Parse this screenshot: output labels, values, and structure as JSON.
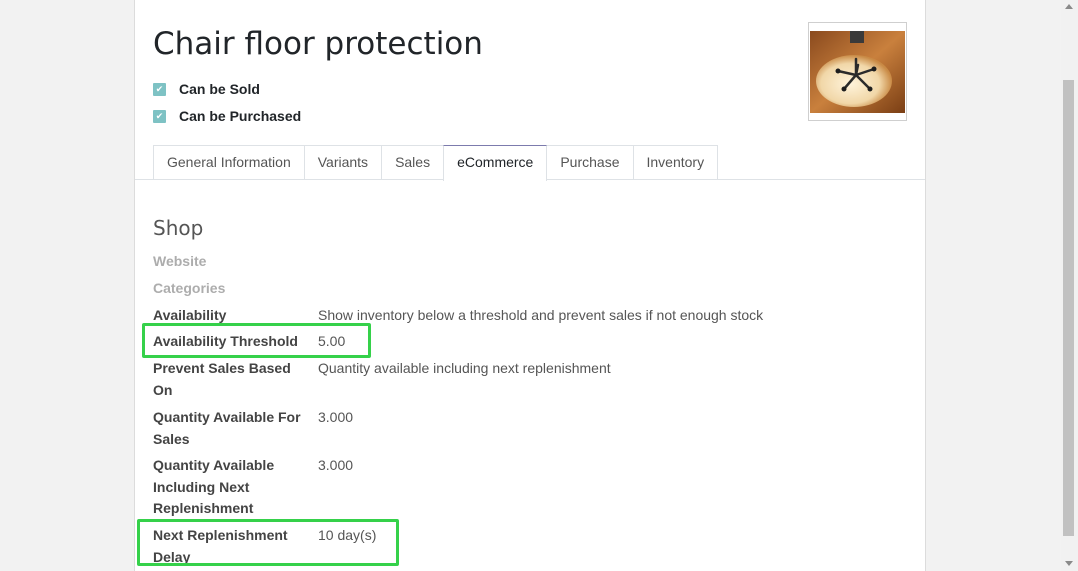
{
  "product": {
    "name": "Chair floor protection",
    "checkboxes": [
      {
        "label": "Can be Sold",
        "checked": true
      },
      {
        "label": "Can be Purchased",
        "checked": true
      }
    ],
    "image_icon": "product-photo-chair-mat"
  },
  "tabs": [
    {
      "label": "General Information",
      "active": false
    },
    {
      "label": "Variants",
      "active": false
    },
    {
      "label": "Sales",
      "active": false
    },
    {
      "label": "eCommerce",
      "active": true
    },
    {
      "label": "Purchase",
      "active": false
    },
    {
      "label": "Inventory",
      "active": false
    }
  ],
  "shop": {
    "title": "Shop",
    "website_label": "Website",
    "categories_label": "Categories",
    "availability_label": "Availability",
    "availability_value": "Show inventory below a threshold and prevent sales if not enough stock",
    "threshold_label": "Availability Threshold",
    "threshold_value": "5.00",
    "prevent_label": "Prevent Sales Based On",
    "prevent_value": "Quantity available including next replenishment",
    "qty_sales_label": "Quantity Available For Sales",
    "qty_sales_value": "3.000",
    "qty_next_label": "Quantity Available Including Next Replenishment",
    "qty_next_value": "3.000",
    "delay_label": "Next Replenishment Delay",
    "delay_value": "10 day(s)"
  },
  "colors": {
    "highlight": "#35d14a",
    "checkbox": "#7ec2c4",
    "active_tab_accent": "#7c7bad"
  }
}
